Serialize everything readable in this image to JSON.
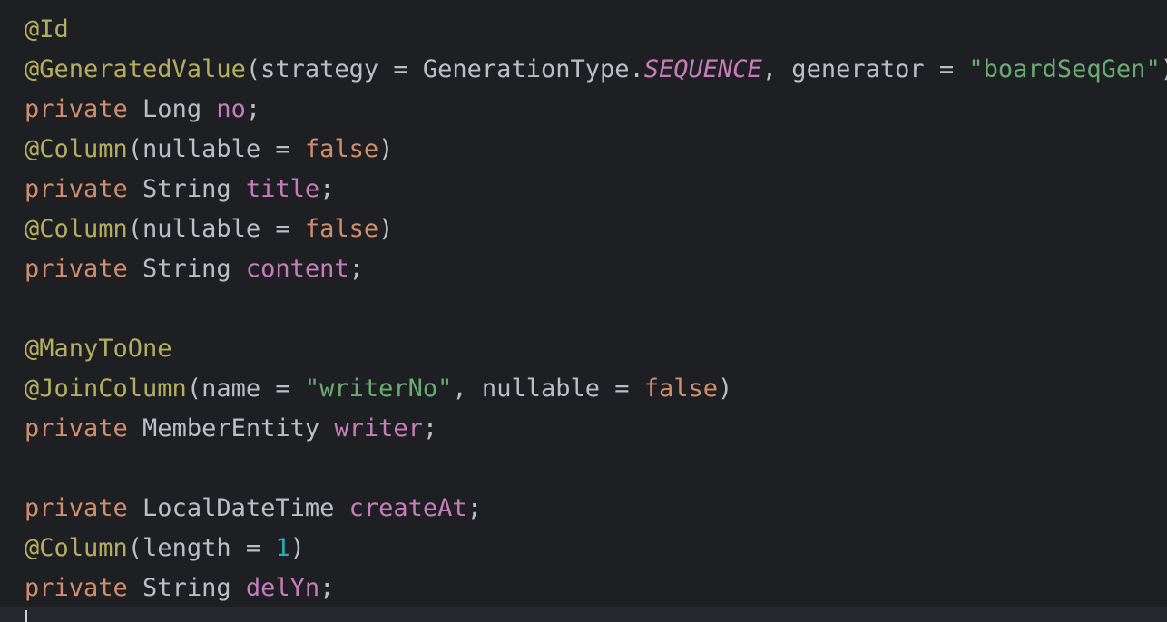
{
  "editor": {
    "colors": {
      "background": "#1e1f22",
      "annotation": "#b3ae60",
      "keyword": "#cf8e6d",
      "field": "#c77dbb",
      "string": "#6aab73",
      "number": "#2aacb8",
      "plain": "#bcbec4",
      "current_line": "#26282e"
    },
    "lines": [
      [
        {
          "t": "@Id",
          "k": "ann"
        }
      ],
      [
        {
          "t": "@GeneratedValue",
          "k": "ann"
        },
        {
          "t": "(strategy = GenerationType.",
          "k": "plain"
        },
        {
          "t": "SEQUENCE",
          "k": "const"
        },
        {
          "t": ", generator = ",
          "k": "plain"
        },
        {
          "t": "\"boardSeqGen\"",
          "k": "str"
        },
        {
          "t": ")",
          "k": "plain"
        }
      ],
      [
        {
          "t": "private",
          "k": "kw"
        },
        {
          "t": " Long ",
          "k": "plain"
        },
        {
          "t": "no",
          "k": "field"
        },
        {
          "t": ";",
          "k": "plain"
        }
      ],
      [
        {
          "t": "@Column",
          "k": "ann"
        },
        {
          "t": "(nullable = ",
          "k": "plain"
        },
        {
          "t": "false",
          "k": "kw"
        },
        {
          "t": ")",
          "k": "plain"
        }
      ],
      [
        {
          "t": "private",
          "k": "kw"
        },
        {
          "t": " String ",
          "k": "plain"
        },
        {
          "t": "title",
          "k": "field"
        },
        {
          "t": ";",
          "k": "plain"
        }
      ],
      [
        {
          "t": "@Column",
          "k": "ann"
        },
        {
          "t": "(nullable = ",
          "k": "plain"
        },
        {
          "t": "false",
          "k": "kw"
        },
        {
          "t": ")",
          "k": "plain"
        }
      ],
      [
        {
          "t": "private",
          "k": "kw"
        },
        {
          "t": " String ",
          "k": "plain"
        },
        {
          "t": "content",
          "k": "field"
        },
        {
          "t": ";",
          "k": "plain"
        }
      ],
      [],
      [
        {
          "t": "@ManyToOne",
          "k": "ann"
        }
      ],
      [
        {
          "t": "@JoinColumn",
          "k": "ann"
        },
        {
          "t": "(name = ",
          "k": "plain"
        },
        {
          "t": "\"writerNo\"",
          "k": "str"
        },
        {
          "t": ", nullable = ",
          "k": "plain"
        },
        {
          "t": "false",
          "k": "kw"
        },
        {
          "t": ")",
          "k": "plain"
        }
      ],
      [
        {
          "t": "private",
          "k": "kw"
        },
        {
          "t": " MemberEntity ",
          "k": "plain"
        },
        {
          "t": "writer",
          "k": "field"
        },
        {
          "t": ";",
          "k": "plain"
        }
      ],
      [],
      [
        {
          "t": "private",
          "k": "kw"
        },
        {
          "t": " LocalDateTime ",
          "k": "plain"
        },
        {
          "t": "createAt",
          "k": "field"
        },
        {
          "t": ";",
          "k": "plain"
        }
      ],
      [
        {
          "t": "@Column",
          "k": "ann"
        },
        {
          "t": "(length = ",
          "k": "plain"
        },
        {
          "t": "1",
          "k": "num"
        },
        {
          "t": ")",
          "k": "plain"
        }
      ],
      [
        {
          "t": "private",
          "k": "kw"
        },
        {
          "t": " String ",
          "k": "plain"
        },
        {
          "t": "delYn",
          "k": "field"
        },
        {
          "t": ";",
          "k": "plain"
        }
      ]
    ]
  }
}
